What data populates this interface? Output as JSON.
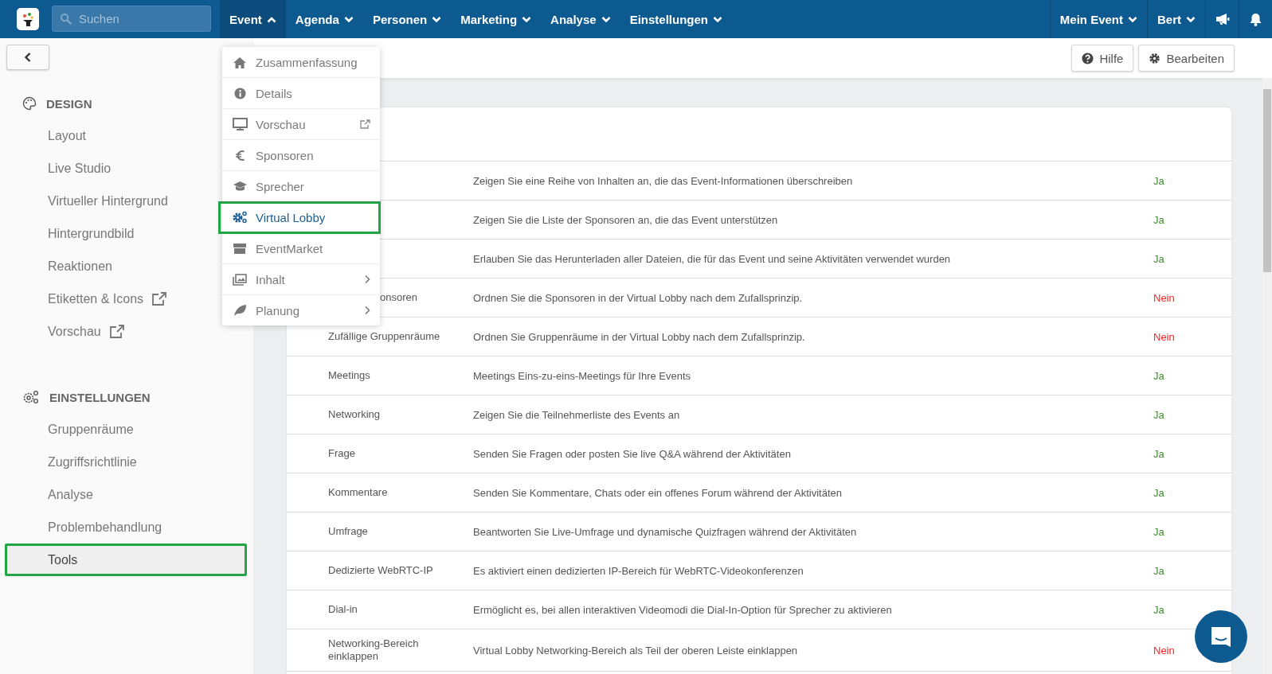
{
  "topbar": {
    "search": {
      "placeholder": "Suchen"
    },
    "nav": [
      {
        "label": "Event",
        "expanded": true
      },
      {
        "label": "Agenda",
        "expanded": false
      },
      {
        "label": "Personen",
        "expanded": false
      },
      {
        "label": "Marketing",
        "expanded": false
      },
      {
        "label": "Analyse",
        "expanded": false
      },
      {
        "label": "Einstellungen",
        "expanded": false
      }
    ],
    "account": [
      {
        "label": "Mein Event"
      },
      {
        "label": "Bert"
      }
    ]
  },
  "event_menu": [
    {
      "label": "Zusammenfassung",
      "selected": false
    },
    {
      "label": "Details",
      "selected": false
    },
    {
      "label": "Vorschau",
      "selected": false,
      "external": true
    },
    {
      "label": "Sponsoren",
      "selected": false
    },
    {
      "label": "Sprecher",
      "selected": false
    },
    {
      "label": "Virtual Lobby",
      "selected": true
    },
    {
      "label": "EventMarket",
      "selected": false
    },
    {
      "label": "Inhalt",
      "selected": false,
      "submenu": true
    },
    {
      "label": "Planung",
      "selected": false,
      "submenu": true
    }
  ],
  "sidebar": [
    {
      "title": "DESIGN",
      "items": [
        {
          "label": "Layout",
          "selected": false
        },
        {
          "label": "Live Studio",
          "selected": false
        },
        {
          "label": "Virtueller Hintergrund",
          "selected": false
        },
        {
          "label": "Hintergrundbild",
          "selected": false
        },
        {
          "label": "Reaktionen",
          "selected": false
        },
        {
          "label": "Etiketten & Icons",
          "selected": false,
          "external": true
        },
        {
          "label": "Vorschau",
          "selected": false,
          "external": true
        }
      ]
    },
    {
      "title": "EINSTELLUNGEN",
      "items": [
        {
          "label": "Gruppenräume",
          "selected": false
        },
        {
          "label": "Zugriffsrichtlinie",
          "selected": false
        },
        {
          "label": "Analyse",
          "selected": false
        },
        {
          "label": "Problembehandlung",
          "selected": false
        },
        {
          "label": "Tools",
          "selected": true
        }
      ]
    }
  ],
  "toolbar": [
    "Hilfe",
    "Bearbeiten"
  ],
  "table": {
    "rows": [
      {
        "description": "Zeigen Sie eine Reihe von Inhalten an, die das Event-Informationen überschreiben",
        "value": "Ja",
        "enabled": true
      },
      {
        "description": "Zeigen Sie die Liste der Sponsoren an, die das Event unterstützen",
        "value": "Ja",
        "enabled": true
      },
      {
        "description": "Erlauben Sie das Herunterladen aller Dateien, die für das Event und seine Aktivitäten verwendet wurden",
        "value": "Ja",
        "enabled": true
      },
      {
        "feature": "onsoren",
        "feature_cut": true,
        "description": "Ordnen Sie die Sponsoren in der Virtual Lobby nach dem Zufallsprinzip.",
        "value": "Nein",
        "enabled": false
      },
      {
        "feature": "Zufällige Gruppenräume",
        "description": "Ordnen Sie Gruppenräume in der Virtual Lobby nach dem Zufallsprinzip.",
        "value": "Nein",
        "enabled": false
      },
      {
        "feature": "Meetings",
        "description": "Meetings Eins-zu-eins-Meetings für Ihre Events",
        "value": "Ja",
        "enabled": true
      },
      {
        "feature": "Networking",
        "description": "Zeigen Sie die Teilnehmerliste des Events an",
        "value": "Ja",
        "enabled": true
      },
      {
        "feature": "Frage",
        "description": "Senden Sie Fragen oder posten Sie live Q&A während der Aktivitäten",
        "value": "Ja",
        "enabled": true
      },
      {
        "feature": "Kommentare",
        "description": "Senden Sie Kommentare, Chats oder ein offenes Forum während der Aktivitäten",
        "value": "Ja",
        "enabled": true
      },
      {
        "feature": "Umfrage",
        "description": "Beantworten Sie Live-Umfrage und dynamische Quizfragen während der Aktivitäten",
        "value": "Ja",
        "enabled": true
      },
      {
        "feature": "Dedizierte WebRTC-IP",
        "description": "Es aktiviert einen dedizierten IP-Bereich für WebRTC-Videokonferenzen",
        "value": "Ja",
        "enabled": true
      },
      {
        "feature": "Dial-in",
        "description": "Ermöglicht es, bei allen interaktiven Videomodi die Dial-In-Option für Sprecher zu aktivieren",
        "value": "Ja",
        "enabled": true
      },
      {
        "feature": "Networking-Bereich einklappen",
        "description": "Virtual Lobby Networking-Bereich als Teil der oberen Leiste einklappen",
        "value": "Nein",
        "enabled": false
      }
    ]
  }
}
